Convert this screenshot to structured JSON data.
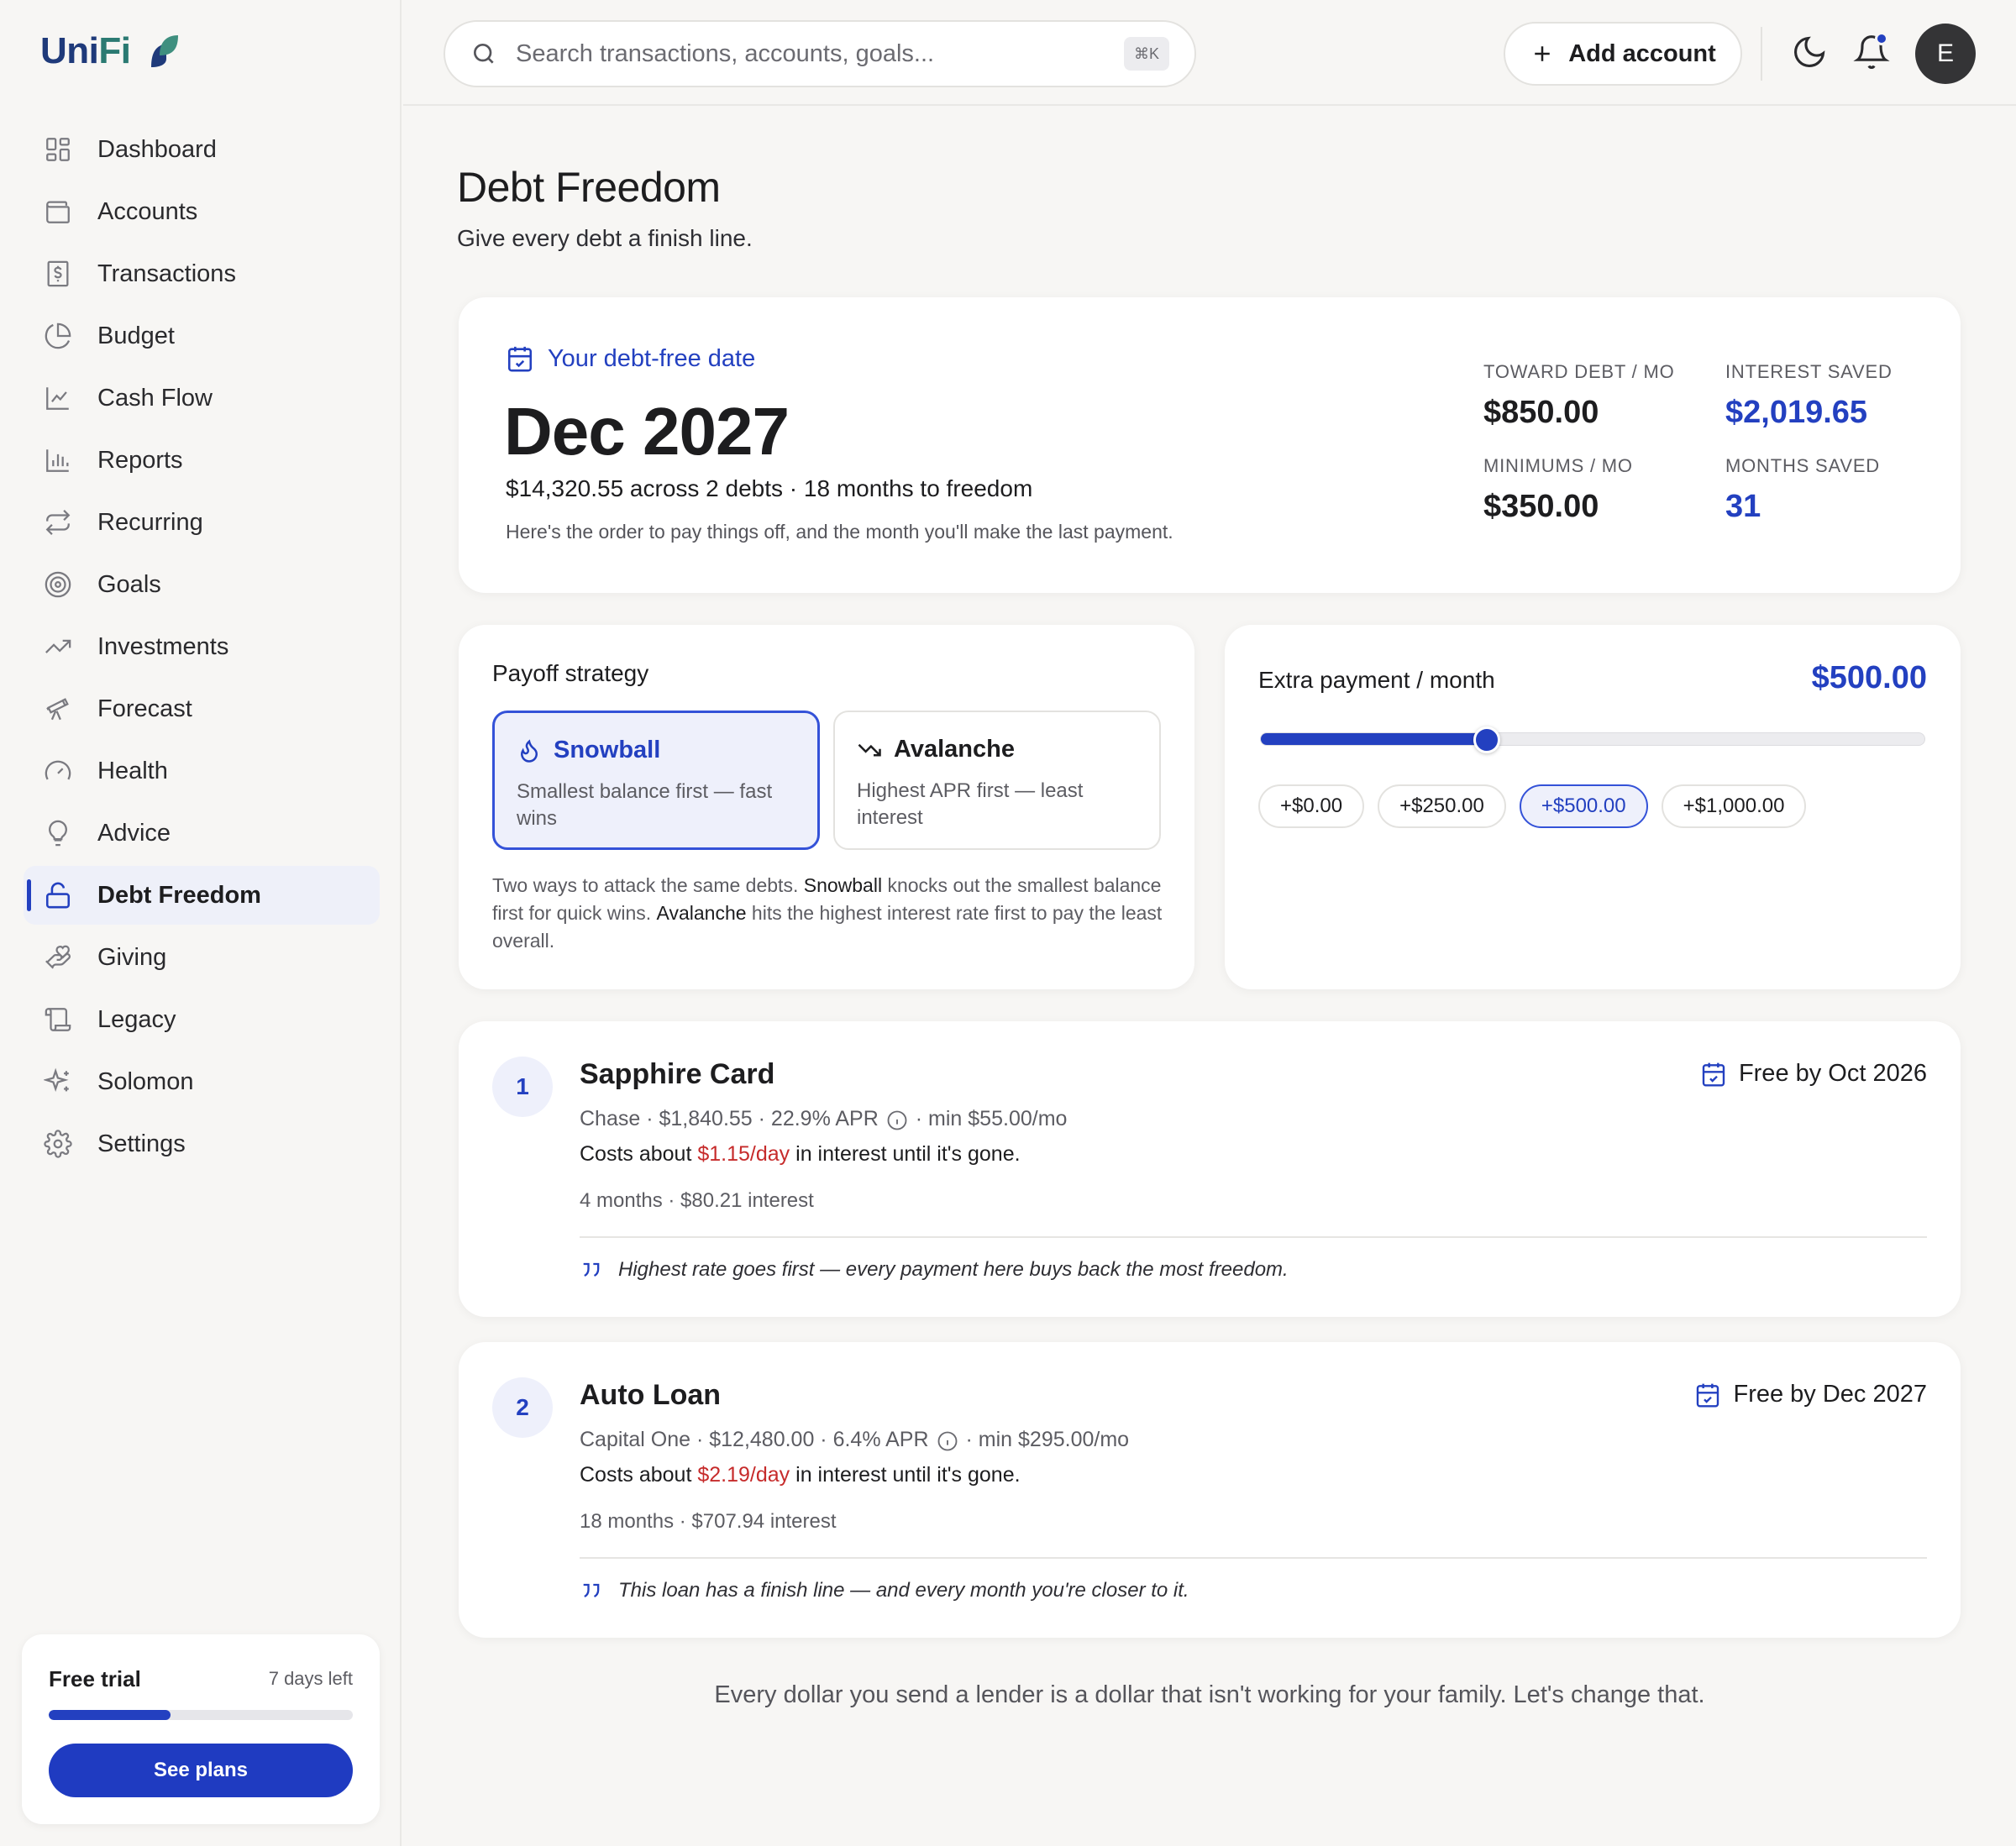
{
  "app": {
    "logo_main": "Uni",
    "logo_accent": "Fi",
    "brand_color": "#1f3a7a",
    "accent_color": "#2340c0",
    "danger_color": "#c62b2b"
  },
  "sidebar": {
    "items": [
      {
        "label": "Dashboard",
        "icon": "dashboard-icon"
      },
      {
        "label": "Accounts",
        "icon": "wallet-icon"
      },
      {
        "label": "Transactions",
        "icon": "receipt-icon"
      },
      {
        "label": "Budget",
        "icon": "pie-chart-icon"
      },
      {
        "label": "Cash Flow",
        "icon": "line-chart-icon"
      },
      {
        "label": "Reports",
        "icon": "bar-chart-icon"
      },
      {
        "label": "Recurring",
        "icon": "repeat-icon"
      },
      {
        "label": "Goals",
        "icon": "target-icon"
      },
      {
        "label": "Investments",
        "icon": "trending-up-icon"
      },
      {
        "label": "Forecast",
        "icon": "telescope-icon"
      },
      {
        "label": "Health",
        "icon": "gauge-icon"
      },
      {
        "label": "Advice",
        "icon": "lightbulb-icon"
      },
      {
        "label": "Debt Freedom",
        "icon": "unlock-icon",
        "active": true
      },
      {
        "label": "Giving",
        "icon": "hand-heart-icon"
      },
      {
        "label": "Legacy",
        "icon": "scroll-icon"
      },
      {
        "label": "Solomon",
        "icon": "sparkles-icon"
      },
      {
        "label": "Settings",
        "icon": "gear-icon"
      }
    ],
    "trial": {
      "title": "Free trial",
      "days_left": "7 days left",
      "progress": 0.4,
      "cta": "See plans"
    }
  },
  "topbar": {
    "search_placeholder": "Search transactions, accounts, goals...",
    "search_shortcut": "⌘K",
    "add_account": "Add account",
    "avatar_initial": "E"
  },
  "page": {
    "title": "Debt Freedom",
    "subtitle": "Give every debt a finish line."
  },
  "hero": {
    "eyebrow": "Your debt-free date",
    "date": "Dec 2027",
    "summary": "$14,320.55 across 2 debts · 18 months to freedom",
    "note": "Here's the order to pay things off, and the month you'll make the last payment.",
    "stats": {
      "toward_label": "TOWARD DEBT / MO",
      "toward_value": "$850.00",
      "interest_label": "INTEREST SAVED",
      "interest_value": "$2,019.65",
      "minimums_label": "MINIMUMS / MO",
      "minimums_value": "$350.00",
      "months_label": "MONTHS SAVED",
      "months_value": "31"
    }
  },
  "strategy": {
    "title": "Payoff strategy",
    "options": [
      {
        "name": "Snowball",
        "desc": "Smallest balance first — fast wins",
        "icon": "flame-icon",
        "selected": true
      },
      {
        "name": "Avalanche",
        "desc": "Highest APR first — least interest",
        "icon": "trending-down-icon",
        "selected": false
      }
    ],
    "explanation": {
      "p1": "Two ways to attack the same debts. ",
      "snowball": "Snowball",
      "p2": " knocks out the smallest balance first for quick wins. ",
      "avalanche": "Avalanche",
      "p3": " hits the highest interest rate first to pay the least overall."
    }
  },
  "extra_payment": {
    "label": "Extra payment / month",
    "value": "$500.00",
    "slider_fraction": 0.34,
    "chips": [
      {
        "label": "+$0.00",
        "selected": false
      },
      {
        "label": "+$250.00",
        "selected": false
      },
      {
        "label": "+$500.00",
        "selected": true
      },
      {
        "label": "+$1,000.00",
        "selected": false
      }
    ]
  },
  "debts": [
    {
      "rank": "1",
      "name": "Sapphire Card",
      "free_by": "Free by Oct 2026",
      "meta_left": "Chase · $1,840.55 · 22.9% APR",
      "meta_right": "· min $55.00/mo",
      "cost_prefix": "Costs about ",
      "cost_rate": "$1.15/day",
      "cost_suffix": " in interest until it's gone.",
      "timeline": "4 months · $80.21 interest",
      "quote": "Highest rate goes first — every payment here buys back the most freedom."
    },
    {
      "rank": "2",
      "name": "Auto Loan",
      "free_by": "Free by Dec 2027",
      "meta_left": "Capital One · $12,480.00 · 6.4% APR",
      "meta_right": "· min $295.00/mo",
      "cost_prefix": "Costs about ",
      "cost_rate": "$2.19/day",
      "cost_suffix": " in interest until it's gone.",
      "timeline": "18 months · $707.94 interest",
      "quote": "This loan has a finish line — and every month you're closer to it."
    }
  ],
  "footer": "Every dollar you send a lender is a dollar that isn't working for your family. Let's change that."
}
